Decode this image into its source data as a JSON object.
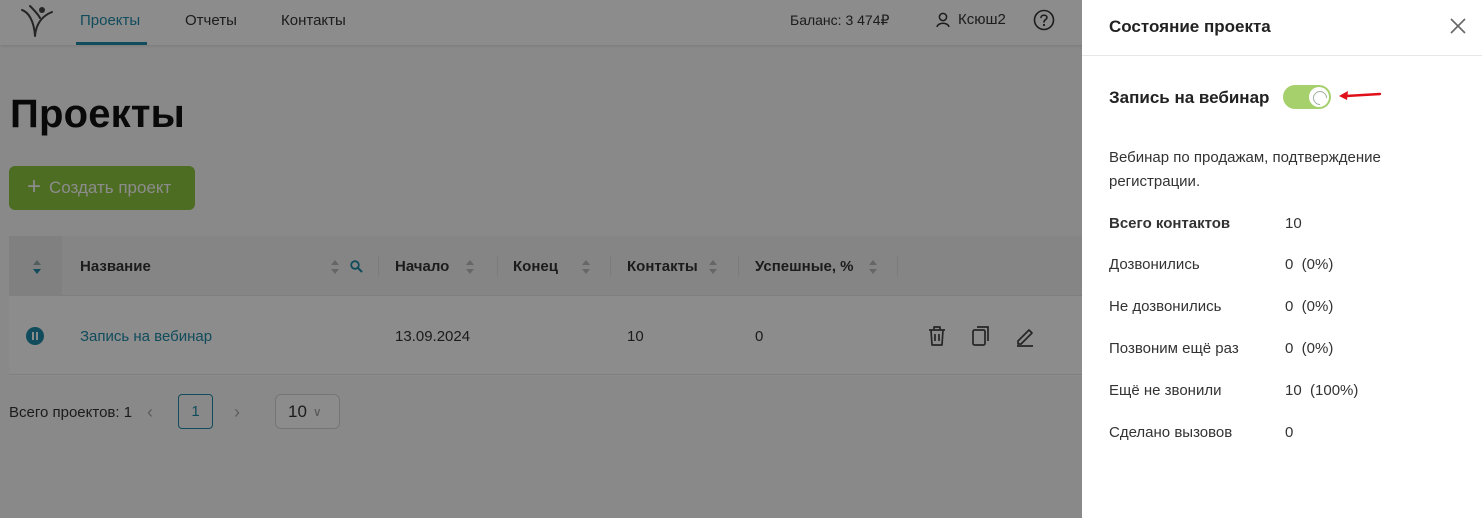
{
  "nav": {
    "items": [
      {
        "label": "Проекты",
        "active": true
      },
      {
        "label": "Отчеты",
        "active": false
      },
      {
        "label": "Контакты",
        "active": false
      }
    ],
    "balance": "Баланс: 3 474₽",
    "user": "Ксюш2",
    "help_icon": "question-circle-icon"
  },
  "page": {
    "title": "Проекты",
    "create_button": "Создать проект"
  },
  "table": {
    "columns": [
      "Название",
      "Начало",
      "Конец",
      "Контакты",
      "Успешные, %"
    ],
    "rows": [
      {
        "name": "Запись на вебинар",
        "start": "13.09.2024",
        "end": "",
        "contacts": "10",
        "success": "0",
        "status": "paused"
      }
    ],
    "row_actions": [
      "trash-icon",
      "copy-icon",
      "edit-icon"
    ]
  },
  "pager": {
    "total": "Всего проектов: 1",
    "current_page": "1",
    "page_size": "10"
  },
  "drawer": {
    "title": "Состояние проекта",
    "project_name": "Запись на вебинар",
    "toggle_on": true,
    "description": "Вебинар по продажам, подтверждение регистрации.",
    "stats": [
      {
        "label": "Всего контактов",
        "value": "10",
        "bold": true
      },
      {
        "label": "Дозвонились",
        "value": "0  (0%)"
      },
      {
        "label": "Не дозвонились",
        "value": "0  (0%)"
      },
      {
        "label": "Позвоним ещё раз",
        "value": "0  (0%)"
      },
      {
        "label": "Ещё не звонили",
        "value": "10  (100%)"
      },
      {
        "label": "Сделано вызовов",
        "value": "0"
      }
    ]
  },
  "colors": {
    "accent": "#1f8aa8",
    "create_button": "#8cc63f",
    "toggle_on": "#a5d06b",
    "annotation_arrow": "#e0101a"
  }
}
